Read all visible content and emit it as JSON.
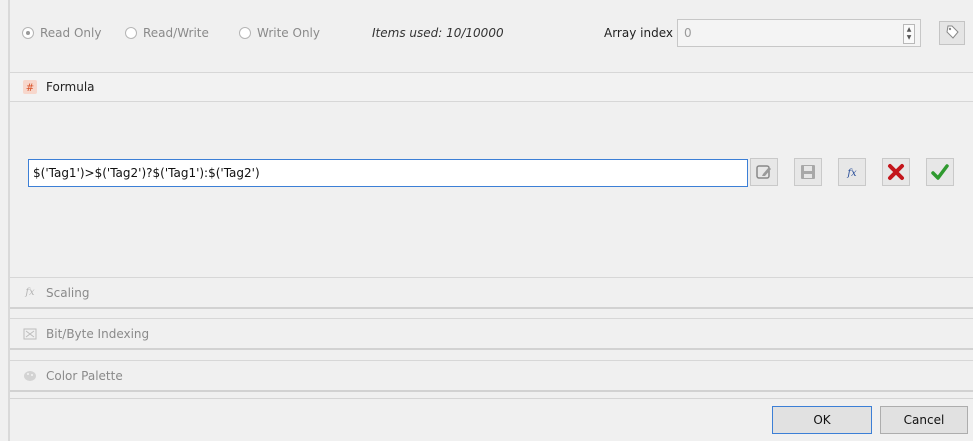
{
  "access_mode": {
    "options": [
      {
        "label": "Read Only",
        "checked": true
      },
      {
        "label": "Read/Write",
        "checked": false
      },
      {
        "label": "Write Only",
        "checked": false
      }
    ]
  },
  "items_used": "Items used:  10/10000",
  "array_index": {
    "label": "Array index",
    "value": "0"
  },
  "formula": {
    "title": "Formula",
    "icon": "formula-icon",
    "expression": "$('Tag1')>$('Tag2')?$('Tag1'):$('Tag2')",
    "toolbar": [
      "edit-icon",
      "save-icon",
      "function-icon",
      "delete-icon",
      "accept-icon"
    ]
  },
  "sections": [
    {
      "label": "Scaling",
      "icon": "fx-icon",
      "enabled": false
    },
    {
      "label": "Bit/Byte Indexing",
      "icon": "bits-icon",
      "enabled": false
    },
    {
      "label": "Color Palette",
      "icon": "palette-icon",
      "enabled": false
    }
  ],
  "buttons": {
    "ok": "OK",
    "cancel": "Cancel"
  },
  "colors": {
    "accent_border": "#3c7fd6",
    "delete": "#c4161c",
    "accept": "#2f9a2f",
    "formula_icon": "#d8542b"
  }
}
